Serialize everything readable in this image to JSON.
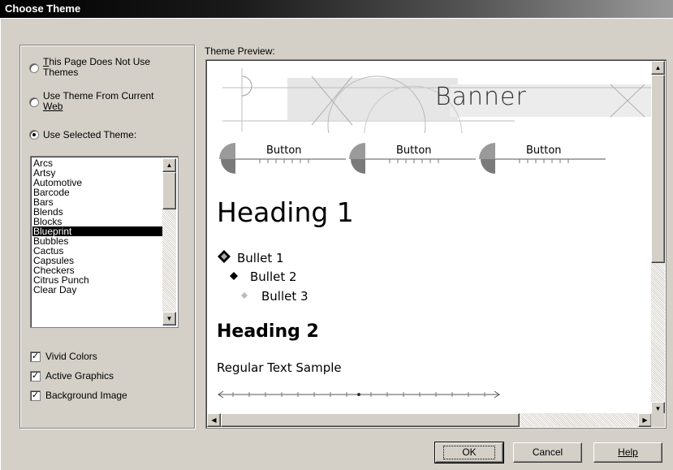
{
  "window": {
    "title": "Choose Theme"
  },
  "options": {
    "no_themes_label_1": "This Page Does Not Use",
    "no_themes_label_2": "Themes",
    "no_themes_mnemonic": "T",
    "current_web_label_1": "Use Theme From Current",
    "current_web_label_2": "Web",
    "selected_theme_label": "Use Selected Theme:",
    "selected_option": "Use Selected Theme:"
  },
  "theme_list": {
    "items": [
      "Arcs",
      "Artsy",
      "Automotive",
      "Barcode",
      "Bars",
      "Blends",
      "Blocks",
      "Blueprint",
      "Bubbles",
      "Cactus",
      "Capsules",
      "Checkers",
      "Citrus Punch",
      "Clear Day"
    ],
    "selected": "Blueprint"
  },
  "checkboxes": {
    "vivid_colors": {
      "label": "Vivid Colors",
      "checked": true
    },
    "active_graphics": {
      "label": "Active Graphics",
      "checked": true
    },
    "background_image": {
      "label": "Background Image",
      "checked": true
    }
  },
  "preview": {
    "label": "Theme Preview:",
    "banner": "Banner",
    "buttons": [
      "Button",
      "Button",
      "Button"
    ],
    "heading1": "Heading 1",
    "bullets": [
      "Bullet 1",
      "Bullet 2",
      "Bullet 3"
    ],
    "heading2": "Heading 2",
    "regular_text": "Regular Text Sample"
  },
  "footer": {
    "ok": "OK",
    "cancel": "Cancel",
    "help": "Help"
  },
  "colors": {
    "title_bar": "#000000",
    "selection": "#000000",
    "dialog_bg": "#d4d0c8"
  }
}
